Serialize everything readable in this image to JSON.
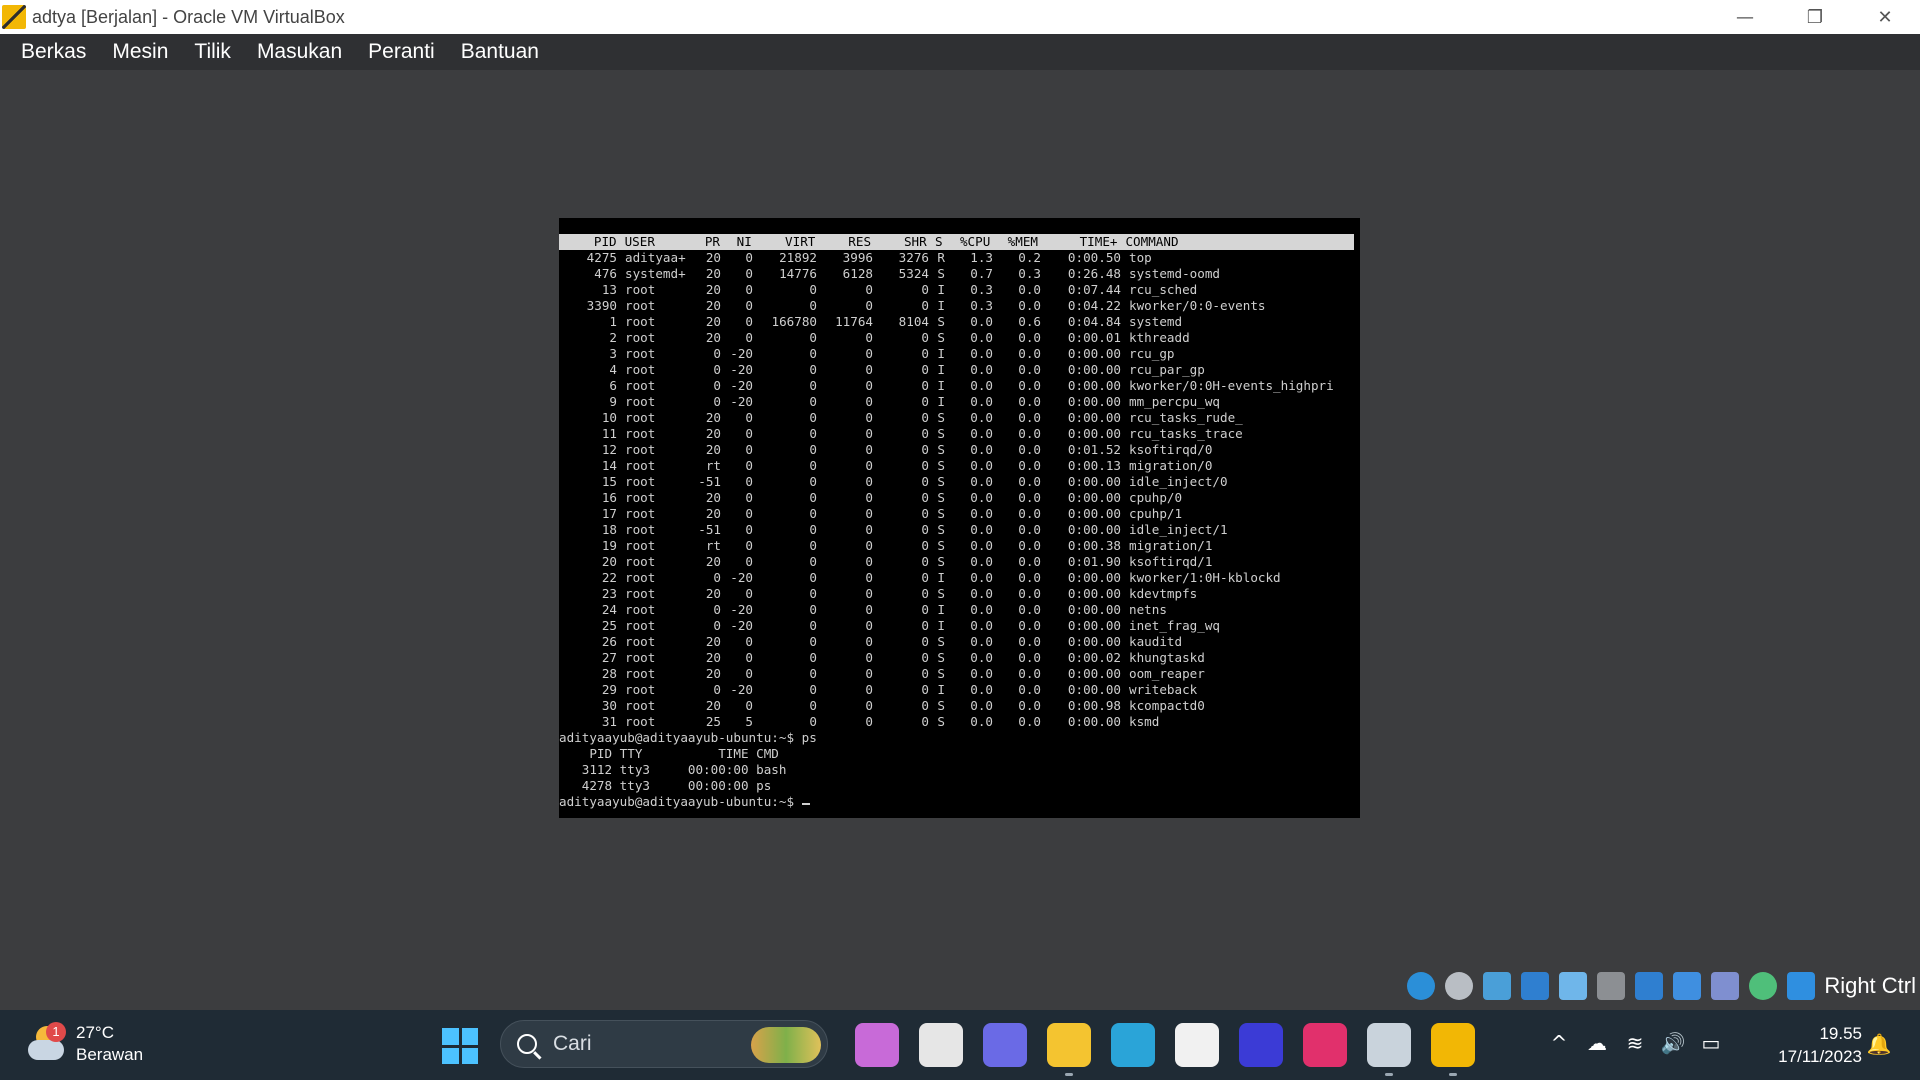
{
  "window": {
    "title": "adtya [Berjalan] - Oracle VM VirtualBox",
    "controls": {
      "minimize": "—",
      "restore": "❐",
      "close": "✕"
    }
  },
  "menu": [
    "Berkas",
    "Mesin",
    "Tilik",
    "Masukan",
    "Peranti",
    "Bantuan"
  ],
  "terminal": {
    "top_header": {
      "pid": "PID",
      "user": "USER",
      "pr": "PR",
      "ni": "NI",
      "virt": "VIRT",
      "res": "RES",
      "shr": "SHR",
      "s": "S",
      "cpu": "%CPU",
      "mem": "%MEM",
      "time": "TIME+",
      "command": "COMMAND"
    },
    "processes": [
      {
        "pid": "4275",
        "user": "adityaa+",
        "pr": "20",
        "ni": "0",
        "virt": "21892",
        "res": "3996",
        "shr": "3276",
        "s": "R",
        "cpu": "1.3",
        "mem": "0.2",
        "time": "0:00.50",
        "command": "top"
      },
      {
        "pid": "476",
        "user": "systemd+",
        "pr": "20",
        "ni": "0",
        "virt": "14776",
        "res": "6128",
        "shr": "5324",
        "s": "S",
        "cpu": "0.7",
        "mem": "0.3",
        "time": "0:26.48",
        "command": "systemd-oomd"
      },
      {
        "pid": "13",
        "user": "root",
        "pr": "20",
        "ni": "0",
        "virt": "0",
        "res": "0",
        "shr": "0",
        "s": "I",
        "cpu": "0.3",
        "mem": "0.0",
        "time": "0:07.44",
        "command": "rcu_sched"
      },
      {
        "pid": "3390",
        "user": "root",
        "pr": "20",
        "ni": "0",
        "virt": "0",
        "res": "0",
        "shr": "0",
        "s": "I",
        "cpu": "0.3",
        "mem": "0.0",
        "time": "0:04.22",
        "command": "kworker/0:0-events"
      },
      {
        "pid": "1",
        "user": "root",
        "pr": "20",
        "ni": "0",
        "virt": "166780",
        "res": "11764",
        "shr": "8104",
        "s": "S",
        "cpu": "0.0",
        "mem": "0.6",
        "time": "0:04.84",
        "command": "systemd"
      },
      {
        "pid": "2",
        "user": "root",
        "pr": "20",
        "ni": "0",
        "virt": "0",
        "res": "0",
        "shr": "0",
        "s": "S",
        "cpu": "0.0",
        "mem": "0.0",
        "time": "0:00.01",
        "command": "kthreadd"
      },
      {
        "pid": "3",
        "user": "root",
        "pr": "0",
        "ni": "-20",
        "virt": "0",
        "res": "0",
        "shr": "0",
        "s": "I",
        "cpu": "0.0",
        "mem": "0.0",
        "time": "0:00.00",
        "command": "rcu_gp"
      },
      {
        "pid": "4",
        "user": "root",
        "pr": "0",
        "ni": "-20",
        "virt": "0",
        "res": "0",
        "shr": "0",
        "s": "I",
        "cpu": "0.0",
        "mem": "0.0",
        "time": "0:00.00",
        "command": "rcu_par_gp"
      },
      {
        "pid": "6",
        "user": "root",
        "pr": "0",
        "ni": "-20",
        "virt": "0",
        "res": "0",
        "shr": "0",
        "s": "I",
        "cpu": "0.0",
        "mem": "0.0",
        "time": "0:00.00",
        "command": "kworker/0:0H-events_highpri"
      },
      {
        "pid": "9",
        "user": "root",
        "pr": "0",
        "ni": "-20",
        "virt": "0",
        "res": "0",
        "shr": "0",
        "s": "I",
        "cpu": "0.0",
        "mem": "0.0",
        "time": "0:00.00",
        "command": "mm_percpu_wq"
      },
      {
        "pid": "10",
        "user": "root",
        "pr": "20",
        "ni": "0",
        "virt": "0",
        "res": "0",
        "shr": "0",
        "s": "S",
        "cpu": "0.0",
        "mem": "0.0",
        "time": "0:00.00",
        "command": "rcu_tasks_rude_"
      },
      {
        "pid": "11",
        "user": "root",
        "pr": "20",
        "ni": "0",
        "virt": "0",
        "res": "0",
        "shr": "0",
        "s": "S",
        "cpu": "0.0",
        "mem": "0.0",
        "time": "0:00.00",
        "command": "rcu_tasks_trace"
      },
      {
        "pid": "12",
        "user": "root",
        "pr": "20",
        "ni": "0",
        "virt": "0",
        "res": "0",
        "shr": "0",
        "s": "S",
        "cpu": "0.0",
        "mem": "0.0",
        "time": "0:01.52",
        "command": "ksoftirqd/0"
      },
      {
        "pid": "14",
        "user": "root",
        "pr": "rt",
        "ni": "0",
        "virt": "0",
        "res": "0",
        "shr": "0",
        "s": "S",
        "cpu": "0.0",
        "mem": "0.0",
        "time": "0:00.13",
        "command": "migration/0"
      },
      {
        "pid": "15",
        "user": "root",
        "pr": "-51",
        "ni": "0",
        "virt": "0",
        "res": "0",
        "shr": "0",
        "s": "S",
        "cpu": "0.0",
        "mem": "0.0",
        "time": "0:00.00",
        "command": "idle_inject/0"
      },
      {
        "pid": "16",
        "user": "root",
        "pr": "20",
        "ni": "0",
        "virt": "0",
        "res": "0",
        "shr": "0",
        "s": "S",
        "cpu": "0.0",
        "mem": "0.0",
        "time": "0:00.00",
        "command": "cpuhp/0"
      },
      {
        "pid": "17",
        "user": "root",
        "pr": "20",
        "ni": "0",
        "virt": "0",
        "res": "0",
        "shr": "0",
        "s": "S",
        "cpu": "0.0",
        "mem": "0.0",
        "time": "0:00.00",
        "command": "cpuhp/1"
      },
      {
        "pid": "18",
        "user": "root",
        "pr": "-51",
        "ni": "0",
        "virt": "0",
        "res": "0",
        "shr": "0",
        "s": "S",
        "cpu": "0.0",
        "mem": "0.0",
        "time": "0:00.00",
        "command": "idle_inject/1"
      },
      {
        "pid": "19",
        "user": "root",
        "pr": "rt",
        "ni": "0",
        "virt": "0",
        "res": "0",
        "shr": "0",
        "s": "S",
        "cpu": "0.0",
        "mem": "0.0",
        "time": "0:00.38",
        "command": "migration/1"
      },
      {
        "pid": "20",
        "user": "root",
        "pr": "20",
        "ni": "0",
        "virt": "0",
        "res": "0",
        "shr": "0",
        "s": "S",
        "cpu": "0.0",
        "mem": "0.0",
        "time": "0:01.90",
        "command": "ksoftirqd/1"
      },
      {
        "pid": "22",
        "user": "root",
        "pr": "0",
        "ni": "-20",
        "virt": "0",
        "res": "0",
        "shr": "0",
        "s": "I",
        "cpu": "0.0",
        "mem": "0.0",
        "time": "0:00.00",
        "command": "kworker/1:0H-kblockd"
      },
      {
        "pid": "23",
        "user": "root",
        "pr": "20",
        "ni": "0",
        "virt": "0",
        "res": "0",
        "shr": "0",
        "s": "S",
        "cpu": "0.0",
        "mem": "0.0",
        "time": "0:00.00",
        "command": "kdevtmpfs"
      },
      {
        "pid": "24",
        "user": "root",
        "pr": "0",
        "ni": "-20",
        "virt": "0",
        "res": "0",
        "shr": "0",
        "s": "I",
        "cpu": "0.0",
        "mem": "0.0",
        "time": "0:00.00",
        "command": "netns"
      },
      {
        "pid": "25",
        "user": "root",
        "pr": "0",
        "ni": "-20",
        "virt": "0",
        "res": "0",
        "shr": "0",
        "s": "I",
        "cpu": "0.0",
        "mem": "0.0",
        "time": "0:00.00",
        "command": "inet_frag_wq"
      },
      {
        "pid": "26",
        "user": "root",
        "pr": "20",
        "ni": "0",
        "virt": "0",
        "res": "0",
        "shr": "0",
        "s": "S",
        "cpu": "0.0",
        "mem": "0.0",
        "time": "0:00.00",
        "command": "kauditd"
      },
      {
        "pid": "27",
        "user": "root",
        "pr": "20",
        "ni": "0",
        "virt": "0",
        "res": "0",
        "shr": "0",
        "s": "S",
        "cpu": "0.0",
        "mem": "0.0",
        "time": "0:00.02",
        "command": "khungtaskd"
      },
      {
        "pid": "28",
        "user": "root",
        "pr": "20",
        "ni": "0",
        "virt": "0",
        "res": "0",
        "shr": "0",
        "s": "S",
        "cpu": "0.0",
        "mem": "0.0",
        "time": "0:00.00",
        "command": "oom_reaper"
      },
      {
        "pid": "29",
        "user": "root",
        "pr": "0",
        "ni": "-20",
        "virt": "0",
        "res": "0",
        "shr": "0",
        "s": "I",
        "cpu": "0.0",
        "mem": "0.0",
        "time": "0:00.00",
        "command": "writeback"
      },
      {
        "pid": "30",
        "user": "root",
        "pr": "20",
        "ni": "0",
        "virt": "0",
        "res": "0",
        "shr": "0",
        "s": "S",
        "cpu": "0.0",
        "mem": "0.0",
        "time": "0:00.98",
        "command": "kcompactd0"
      },
      {
        "pid": "31",
        "user": "root",
        "pr": "25",
        "ni": "5",
        "virt": "0",
        "res": "0",
        "shr": "0",
        "s": "S",
        "cpu": "0.0",
        "mem": "0.0",
        "time": "0:00.00",
        "command": "ksmd"
      }
    ],
    "prompt_ps": "adityaayub@adityaayub-ubuntu:~$ ps",
    "ps_header": "    PID TTY          TIME CMD",
    "ps_rows": [
      "   3112 tty3     00:00:00 bash",
      "   4278 tty3     00:00:00 ps"
    ],
    "prompt_current": "adityaayub@adityaayub-ubuntu:~$ "
  },
  "vm_status": {
    "icons": [
      "hard-disk-icon",
      "optical-drive-icon",
      "audio-icon",
      "network-icon",
      "usb-icon",
      "shared-folders-icon",
      "display-icon",
      "recording-icon",
      "vt-x-icon",
      "mouse-integration-icon",
      "keyboard-capture-icon"
    ],
    "host_key": "Right Ctrl"
  },
  "taskbar": {
    "weather": {
      "temperature": "27°C",
      "condition": "Berawan",
      "badge": "1"
    },
    "search_placeholder": "Cari",
    "apps": [
      {
        "name": "copilot-app-icon",
        "color": "#c86ad8"
      },
      {
        "name": "task-view-icon",
        "color": "#e6e6e6"
      },
      {
        "name": "teams-meet-icon",
        "color": "#6a6ae6"
      },
      {
        "name": "file-explorer-icon",
        "color": "#f4c430"
      },
      {
        "name": "edge-browser-icon",
        "color": "#2aa4d8"
      },
      {
        "name": "microsoft-store-icon",
        "color": "#f1f1f1"
      },
      {
        "name": "ai-app-icon",
        "color": "#3b3bd6"
      },
      {
        "name": "instagram-icon",
        "color": "#e1306c"
      },
      {
        "name": "virtualbox-manager-icon",
        "color": "#c9d3dc"
      },
      {
        "name": "virtualbox-vm-icon",
        "color": "#f2b705"
      }
    ],
    "tray": {
      "chevron": "^",
      "onedrive": "☁",
      "wifi": "≋",
      "volume": "🔊",
      "battery": "▭"
    },
    "clock": {
      "time": "19.55",
      "date": "17/11/2023"
    },
    "bell": "🔔"
  }
}
